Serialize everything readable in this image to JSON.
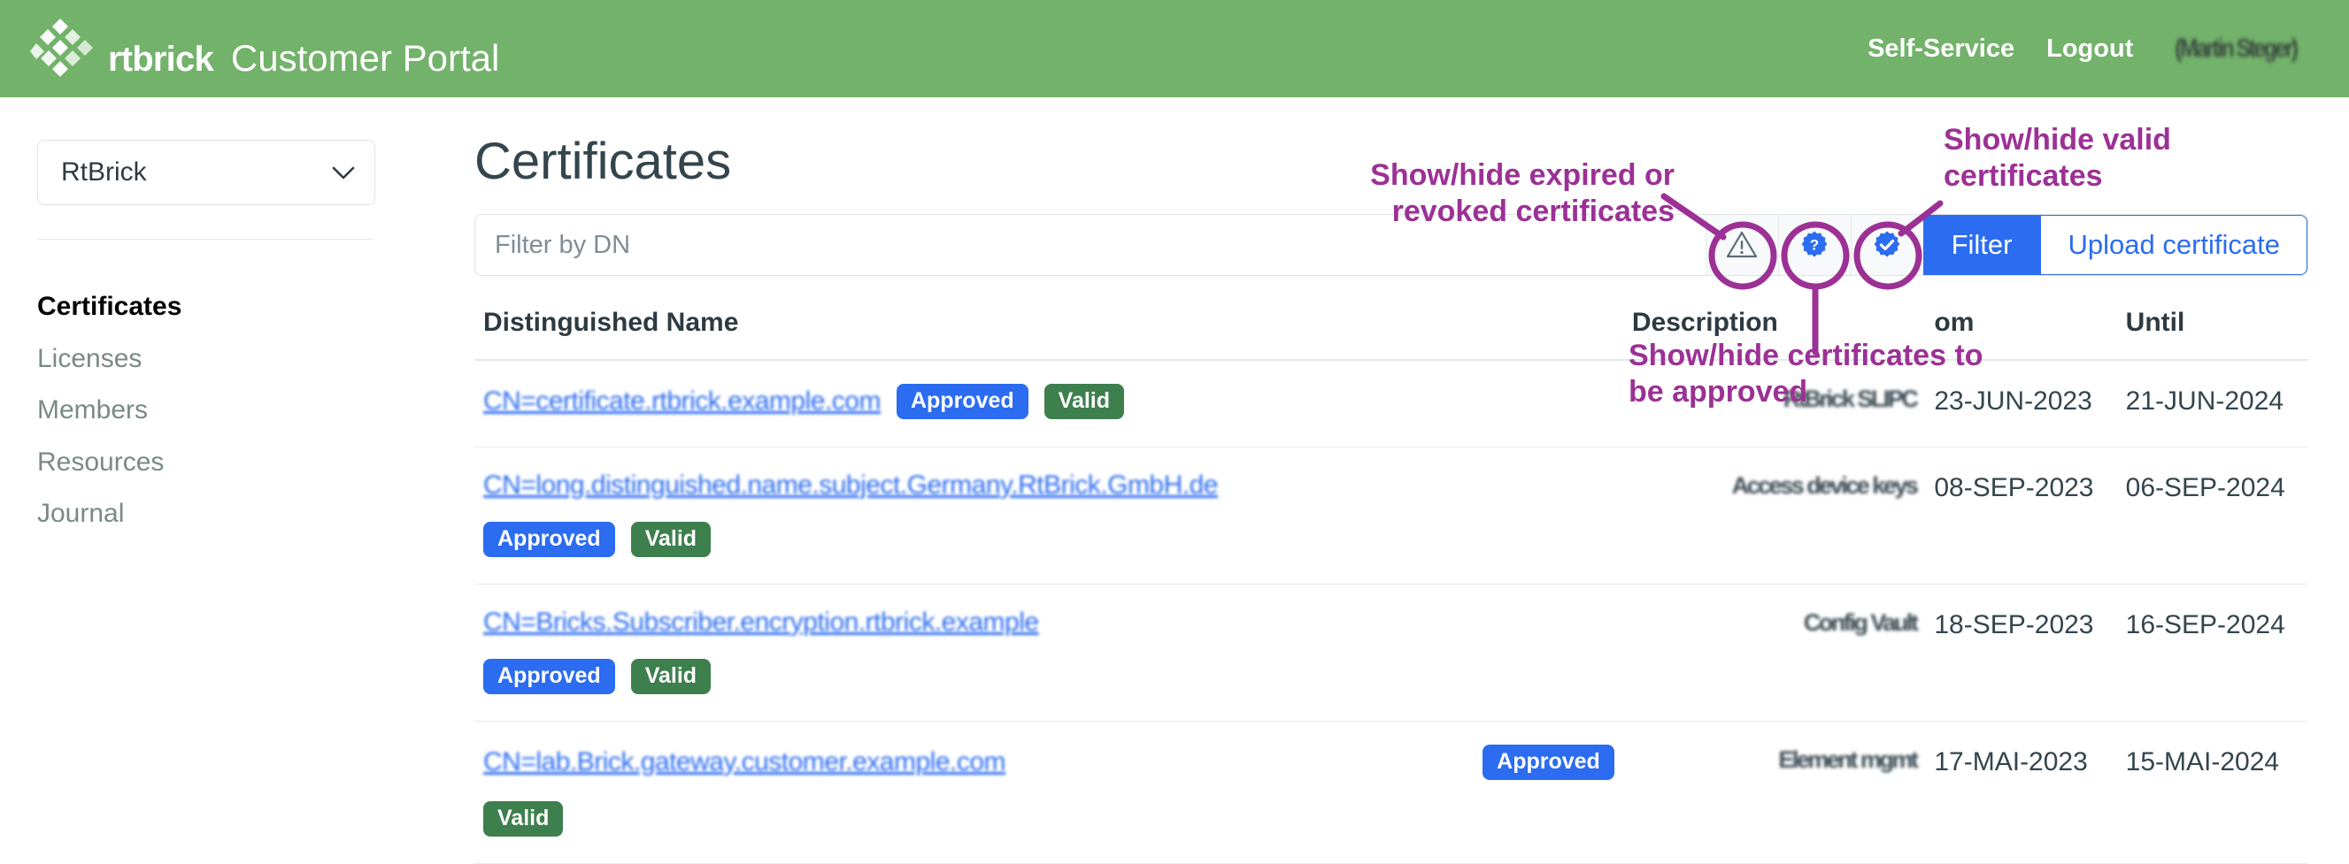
{
  "header": {
    "brand_name": "rtbrick",
    "portal_title": "Customer Portal",
    "logo_icon": "rtbrick-cubes-logo",
    "self_service_label": "Self-Service",
    "logout_label": "Logout",
    "user_name": "(Martin Steger)",
    "bg_color": "#72b26a"
  },
  "sidebar": {
    "org_selector": {
      "value": "RtBrick",
      "chevron_icon": "chevron-down-icon"
    },
    "items": [
      {
        "label": "Certificates",
        "active": true
      },
      {
        "label": "Licenses",
        "active": false
      },
      {
        "label": "Members",
        "active": false
      },
      {
        "label": "Resources",
        "active": false
      },
      {
        "label": "Journal",
        "active": false
      }
    ]
  },
  "main": {
    "page_title": "Certificates",
    "filter": {
      "placeholder": "Filter by DN",
      "value": "",
      "toggles": [
        {
          "name": "expired-revoked-toggle",
          "icon": "warning-triangle-icon"
        },
        {
          "name": "to-be-approved-toggle",
          "icon": "question-badge-icon"
        },
        {
          "name": "valid-toggle",
          "icon": "check-badge-icon"
        }
      ],
      "filter_button": "Filter",
      "upload_button": "Upload certificate",
      "accent_color": "#2b6cf0"
    },
    "table": {
      "columns": [
        "Distinguished Name",
        "Description",
        "om",
        "Until"
      ],
      "rows": [
        {
          "dn": "CN=certificate.rtbrick.example.com",
          "badges": [
            "Approved",
            "Valid"
          ],
          "badge_layout": "inline",
          "description": "RtBrick SLIPC",
          "from": "23-JUN-2023",
          "until": "21-JUN-2024"
        },
        {
          "dn": "CN=long.distinguished.name.subject.Germany.RtBrick.GmbH.de",
          "badges": [
            "Approved",
            "Valid"
          ],
          "badge_layout": "wrap",
          "description": "Access device keys",
          "from": "08-SEP-2023",
          "until": "06-SEP-2024"
        },
        {
          "dn": "CN=Bricks.Subscriber.encryption.rtbrick.example",
          "badges": [
            "Approved",
            "Valid"
          ],
          "badge_layout": "wrap",
          "description": "Config Vault",
          "from": "18-SEP-2023",
          "until": "16-SEP-2024"
        },
        {
          "dn": "CN=lab.Brick.gateway.customer.example.com",
          "badges": [
            "Approved",
            "Valid"
          ],
          "badge_layout": "split",
          "description": "Element mgmt",
          "from": "17-MAI-2023",
          "until": "15-MAI-2024"
        }
      ]
    }
  },
  "annotations": {
    "color": "#9c3195",
    "items": [
      {
        "name": "annotation-expired-revoked",
        "text": "Show/hide expired or\nrevoked certificates"
      },
      {
        "name": "annotation-valid",
        "text": "Show/hide valid\ncertificates"
      },
      {
        "name": "annotation-to-be-approved",
        "text": "Show/hide certificates to\nbe approved"
      }
    ]
  }
}
